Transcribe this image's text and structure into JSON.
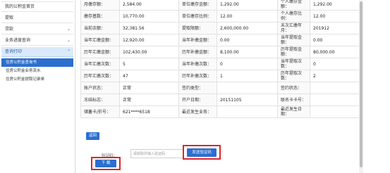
{
  "sidebar": {
    "items": [
      {
        "label": "我的公积金首页"
      },
      {
        "label": "提取"
      },
      {
        "label": "贷款"
      },
      {
        "label": "业务进度查询"
      },
      {
        "label": "查询打印"
      }
    ],
    "subitems": [
      {
        "label": "住房公积金查询书"
      },
      {
        "label": "住房公积金业务流水"
      },
      {
        "label": "住房公积金提取记录单"
      }
    ]
  },
  "detail": {
    "rows": [
      [
        "月缴存额：",
        "2,584.00",
        "单位缴存金额：",
        "1,292.00",
        "个人缴存金额：",
        "1,292.00"
      ],
      [
        "缴存基数：",
        "10,770.00",
        "单位缴存比例：",
        "12.00",
        "个人缴存比例：",
        "12.00"
      ],
      [
        "当前余额：",
        "32,381.56",
        "提取限额：",
        "2,600,000.00",
        "末次汇缴年月：",
        "201912"
      ],
      [
        "当年汇缴金额：",
        "12,920.00",
        "当年补缴金额：",
        "0.00",
        "当年提取金额：",
        "0.00"
      ],
      [
        "历年汇缴金额：",
        "102,430.00",
        "历年补缴金额：",
        "8,100.00",
        "历年提取金额：",
        "80,000.00"
      ],
      [
        "当年汇缴次数：",
        "5",
        "当年补缴次数：",
        "0",
        "当年提取次数：",
        "0"
      ],
      [
        "历年汇缴次数：",
        "47",
        "历年补缴次数：",
        "1",
        "历年提取次数：",
        "2"
      ],
      [
        "账户状态：",
        "正常",
        "签约类型：",
        "",
        "签约状态：",
        ""
      ],
      [
        "冻结标志：",
        "正常",
        "开户日期：",
        "20151105",
        "联名卡卡号：",
        ""
      ],
      [
        "储蓄卡/折号：",
        "621****6518",
        "最近发生业务：",
        "",
        "最近发生日期：",
        ""
      ]
    ]
  },
  "actions": {
    "return_label": "返回",
    "code_label": "验证码：",
    "code_placeholder": "请获取并输入验证码",
    "send_code_label": "发送验证码",
    "download_label": "下 载"
  },
  "colors": {
    "primary": "#2b6fd0",
    "highlight_border": "#e0232a",
    "active_bg": "#dbeafa"
  }
}
